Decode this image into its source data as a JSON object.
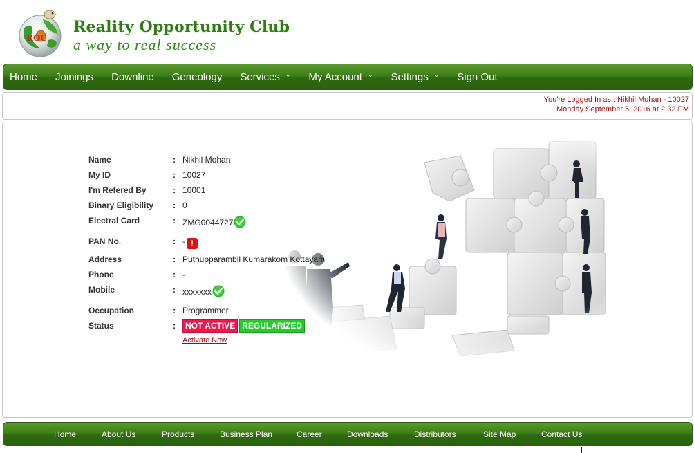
{
  "brand": {
    "logo_text": "ROC",
    "title": "Reality Opportunity Club",
    "tagline": "a way to real success"
  },
  "top_nav": [
    {
      "label": "Home",
      "dropdown": false
    },
    {
      "label": "Joinings",
      "dropdown": false
    },
    {
      "label": "Downline",
      "dropdown": false
    },
    {
      "label": "Geneology",
      "dropdown": false
    },
    {
      "label": "Services",
      "dropdown": true
    },
    {
      "label": "My Account",
      "dropdown": true
    },
    {
      "label": "Settings",
      "dropdown": true
    },
    {
      "label": "Sign Out",
      "dropdown": false
    }
  ],
  "session": {
    "logged_in_text": "You're Logged In as : Nikhil Mohan - 10027",
    "datetime_text": "Monday September 5, 2016 at 2:32 PM"
  },
  "profile": {
    "name_label": "Name",
    "name_value": "Nikhil Mohan",
    "id_label": "My ID",
    "id_value": "10027",
    "referred_label": "I'm Refered By",
    "referred_value": "10001",
    "binary_label": "Binary Eligibility",
    "binary_value": "0",
    "card_label": "Electral Card",
    "card_value": "ZMG0044727",
    "pan_label": "PAN No.",
    "pan_value": "-",
    "address_label": "Address",
    "address_value": "Puthupparambil Kumarakom Kottayam",
    "phone_label": "Phone",
    "phone_value": "-",
    "mobile_label": "Mobile",
    "mobile_value": "xxxxxxx",
    "occupation_label": "Occupation",
    "occupation_value": "Programmer",
    "status_label": "Status",
    "status_inactive": "NOT ACTIVE",
    "status_regularized": "REGULARIZED",
    "activate_link": "Activate Now",
    "colon": ":"
  },
  "footer_nav": [
    "Home",
    "About Us",
    "Products",
    "Business Plan",
    "Career",
    "Downloads",
    "Distributors",
    "Site Map",
    "Contact Us"
  ],
  "colors": {
    "brand_green": "#2f7d12",
    "nav_green": "#3f7f1a",
    "session_red": "#9b1111",
    "inactive_badge": "#f2154e",
    "regularized_badge": "#28c82e",
    "warning_red": "#d71414"
  },
  "icons": {
    "ok": "green-check-icon",
    "warning": "red-exclamation-icon",
    "logo": "globe-bird-logo"
  }
}
